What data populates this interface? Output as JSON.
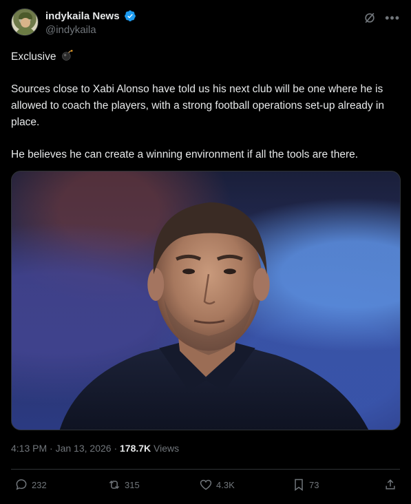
{
  "author": {
    "display_name": "indykaila News",
    "handle": "@indykaila",
    "verified": true
  },
  "post": {
    "line1": "Exclusive",
    "line1_emoji": "bomb-icon",
    "paragraph1": "Sources close to Xabi Alonso have told us his next club will be one where he is allowed to coach the players, with a strong football operations set-up already in place.",
    "paragraph2": "He believes he can create a winning environment if all the tools are there."
  },
  "meta": {
    "time": "4:13 PM",
    "separator1": " · ",
    "date": "Jan 13, 2026",
    "separator2": " · ",
    "views_count": "178.7K",
    "views_label": " Views"
  },
  "actions": {
    "replies": "232",
    "reposts": "315",
    "likes": "4.3K",
    "bookmarks": "73"
  },
  "colors": {
    "background": "#000000",
    "text": "#e7e9ea",
    "muted": "#71767b",
    "verified": "#1d9bf0",
    "border": "#2f3336"
  }
}
